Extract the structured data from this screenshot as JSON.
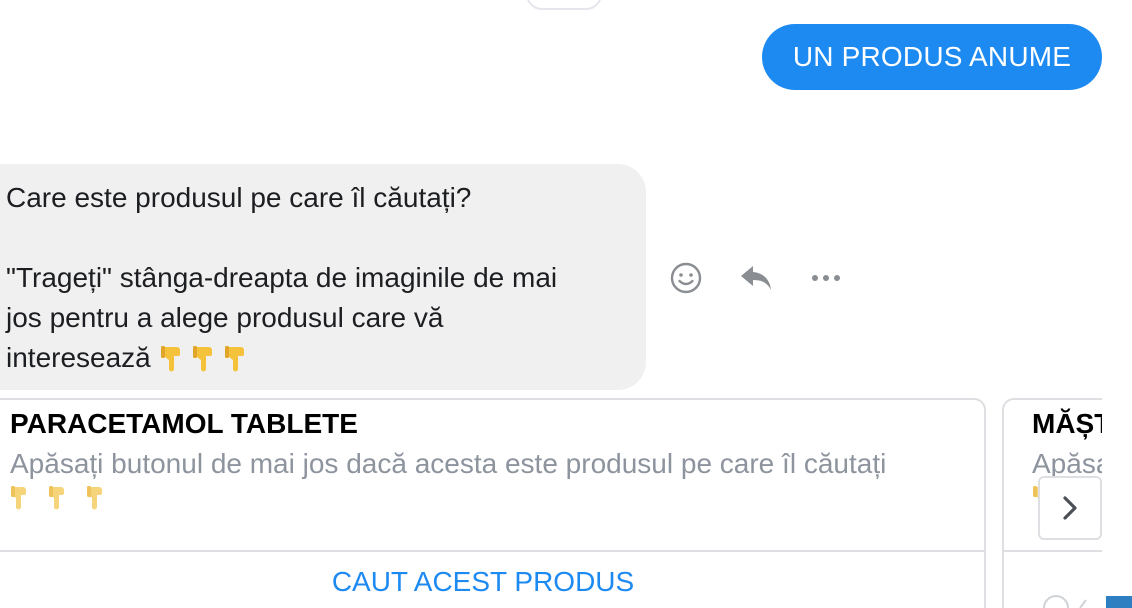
{
  "sent_message": {
    "text": "UN PRODUS ANUME"
  },
  "received_message": {
    "line1": "Care este produsul pe care îl căutați?",
    "line2": "\"Trageți\" stânga-dreapta de imaginile de mai",
    "line3": "jos pentru a alege produsul care vă",
    "line4": "interesează",
    "hand_icons": [
      "pointing-down-icon",
      "pointing-down-icon",
      "pointing-down-icon"
    ]
  },
  "message_actions": [
    "emoji-reaction-icon",
    "reply-icon",
    "more-options-icon"
  ],
  "carousel": {
    "cards": [
      {
        "title": "PARACETAMOL TABLETE",
        "subtitle": "Apăsați butonul de mai jos dacă acesta este produsul pe care îl căutați",
        "button": "CAUT ACEST PRODUS"
      },
      {
        "title": "MĂȘT",
        "subtitle": "Apăsa"
      }
    ],
    "next_icon": "chevron-right-icon"
  },
  "colors": {
    "sent_bubble": "#1d8af2",
    "received_bubble": "#f0f0f0",
    "link_blue": "#1d8af2",
    "subtitle_gray": "#8d949e",
    "border": "#dddfe2",
    "hand_yellow": "#f5c33b"
  }
}
